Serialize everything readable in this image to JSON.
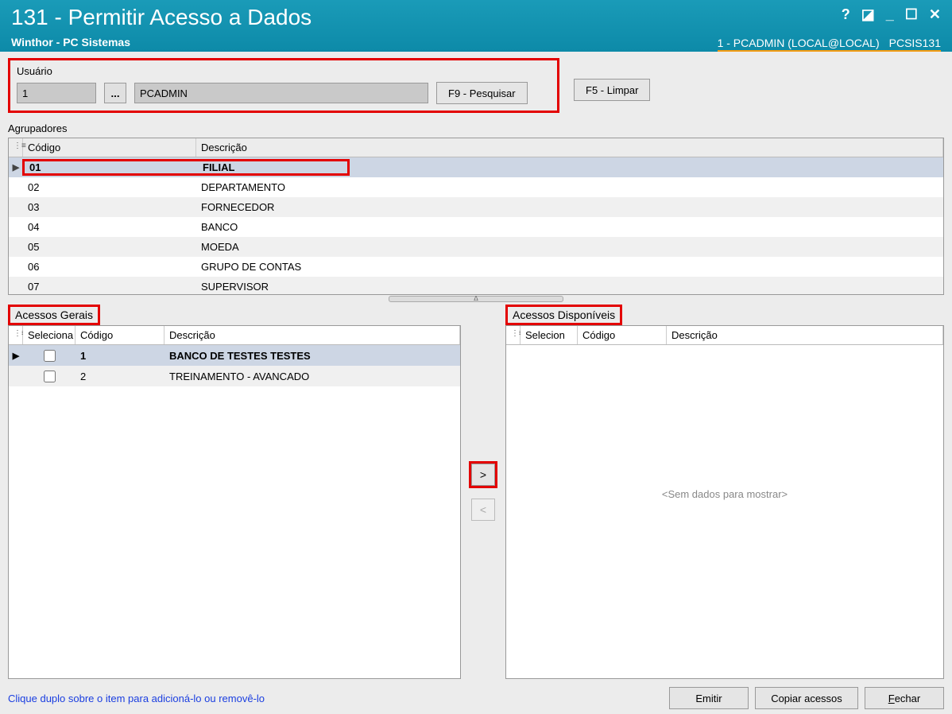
{
  "window": {
    "title": "131 - Permitir Acesso a Dados",
    "subtitle": "Winthor - PC Sistemas",
    "context_user": "1 - PCADMIN (LOCAL@LOCAL)",
    "context_mod": "PCSIS131"
  },
  "usuario": {
    "group_label": "Usuário",
    "code": "1",
    "name": "PCADMIN",
    "search_btn": "F9 - Pesquisar",
    "clear_btn": "F5 - Limpar"
  },
  "agrupadores": {
    "label": "Agrupadores",
    "col_code": "Código",
    "col_desc": "Descrição",
    "rows": [
      {
        "code": "01",
        "desc": "FILIAL"
      },
      {
        "code": "02",
        "desc": "DEPARTAMENTO"
      },
      {
        "code": "03",
        "desc": "FORNECEDOR"
      },
      {
        "code": "04",
        "desc": "BANCO"
      },
      {
        "code": "05",
        "desc": "MOEDA"
      },
      {
        "code": "06",
        "desc": "GRUPO DE CONTAS"
      },
      {
        "code": "07",
        "desc": "SUPERVISOR"
      }
    ]
  },
  "acessos_gerais": {
    "label": "Acessos Gerais",
    "col_sel": "Seleciona",
    "col_code": "Código",
    "col_desc": "Descrição",
    "rows": [
      {
        "code": "1",
        "desc": "BANCO DE TESTES TESTES"
      },
      {
        "code": "2",
        "desc": "TREINAMENTO - AVANCADO"
      }
    ]
  },
  "acessos_disp": {
    "label": "Acessos Disponíveis",
    "col_sel": "Selecion",
    "col_code": "Código",
    "col_desc": "Descrição",
    "empty": "<Sem dados para mostrar>"
  },
  "move": {
    "right": ">",
    "left": "<"
  },
  "footer": {
    "hint": "Clique duplo sobre o item para adicioná-lo ou removê-lo",
    "emit": "Emitir",
    "copy": "Copiar acessos",
    "close": "Fechar"
  },
  "icons": {
    "help": "?",
    "edit": "◪",
    "min": "_",
    "max": "☐",
    "close": "✕",
    "dots": "...",
    "splitter": "ᐃ"
  }
}
